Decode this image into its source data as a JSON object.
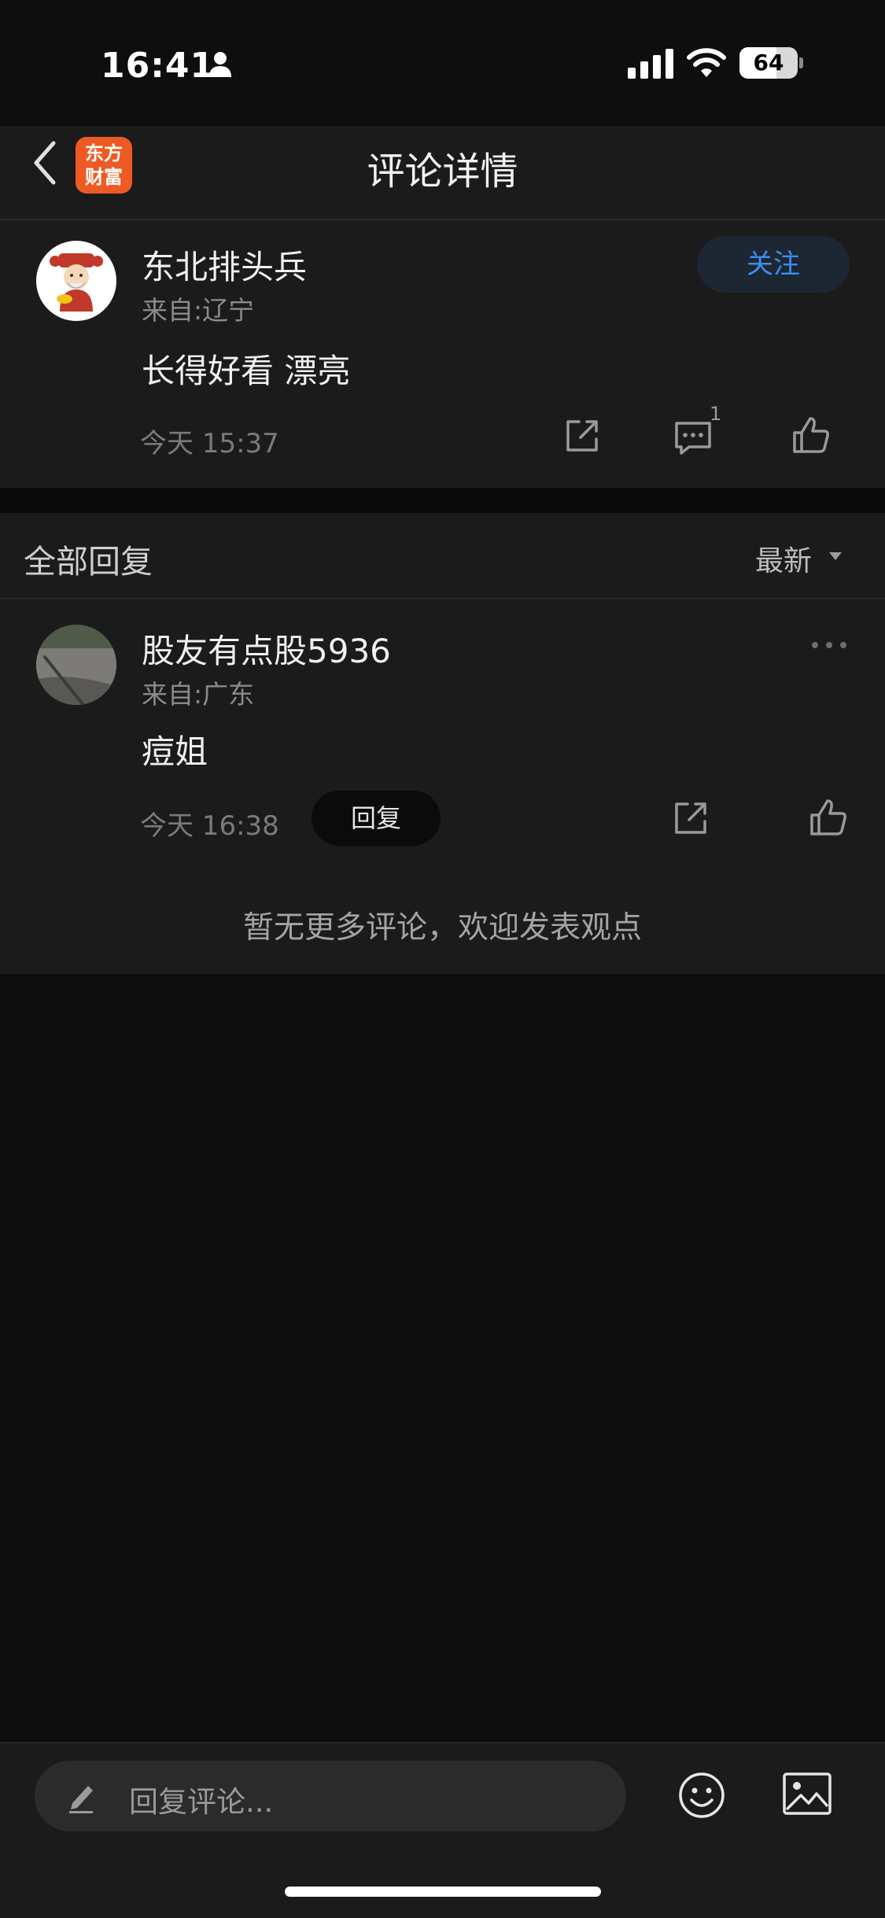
{
  "status_bar": {
    "time": "16:41",
    "battery_level": "64",
    "battery_fraction": 0.64
  },
  "nav": {
    "title": "评论详情",
    "logo_line1": "东方",
    "logo_line2": "财富",
    "brand_color": "#ee5a24"
  },
  "comment": {
    "author": "东北排头兵",
    "location": "来自:辽宁",
    "follow_label": "关注",
    "text": "长得好看 漂亮",
    "time": "今天 15:37",
    "reply_count": "1",
    "icons": [
      "share-icon",
      "comment-icon",
      "like-icon"
    ]
  },
  "replies": {
    "header": "全部回复",
    "sort_label": "最新",
    "items": [
      {
        "author": "股友有点股5936",
        "location": "来自:广东",
        "text": "痘姐",
        "time": "今天 16:38",
        "reply_label": "回复"
      }
    ],
    "empty_message": "暂无更多评论，欢迎发表观点"
  },
  "bottom_bar": {
    "input_placeholder": "回复评论...",
    "icons": [
      "pencil-icon",
      "emoji-icon",
      "image-icon"
    ]
  },
  "colors": {
    "background": "#0e0e0e",
    "card": "#1b1b1b",
    "follow_text": "#3d8cf0"
  }
}
